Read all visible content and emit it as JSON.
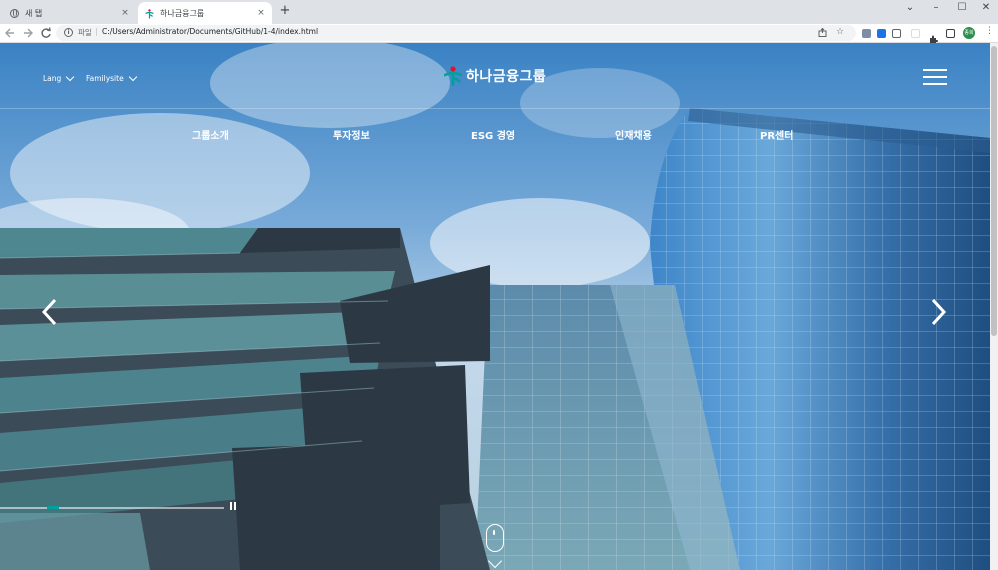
{
  "browser": {
    "tabs": [
      {
        "title": "새 탭",
        "active": false
      },
      {
        "title": "하나금융그룹",
        "active": true
      }
    ],
    "new_tab_symbol": "+",
    "close_symbol": "×",
    "window_controls": {
      "menu": "⌄",
      "minimize": "–",
      "maximize": "☐",
      "close": "✕"
    },
    "omnibox": {
      "scheme_label": "파일",
      "separator": "|",
      "url": "C:/Users/Administrator/Documents/GitHub/1-4/index.html"
    },
    "profile_initials": "종희"
  },
  "header": {
    "lang_label": "Lang",
    "familysite_label": "Familysite",
    "logo_text": "하나금융그룹",
    "nav_items": [
      "그룹소개",
      "투자정보",
      "ESG 경영",
      "인재채용",
      "PR센터"
    ]
  },
  "colors": {
    "brand_green": "#00a19c",
    "brand_red": "#e8112d",
    "text_on_hero": "#ffffff"
  },
  "icons": {
    "back": "arrow-left",
    "forward": "arrow-right",
    "reload": "reload",
    "info": "info-circle",
    "share": "share",
    "bookmark": "star",
    "extensions": "puzzle",
    "menu": "vertical-ellipsis"
  },
  "slider": {
    "slide_count": 4,
    "current_slide": 1
  }
}
